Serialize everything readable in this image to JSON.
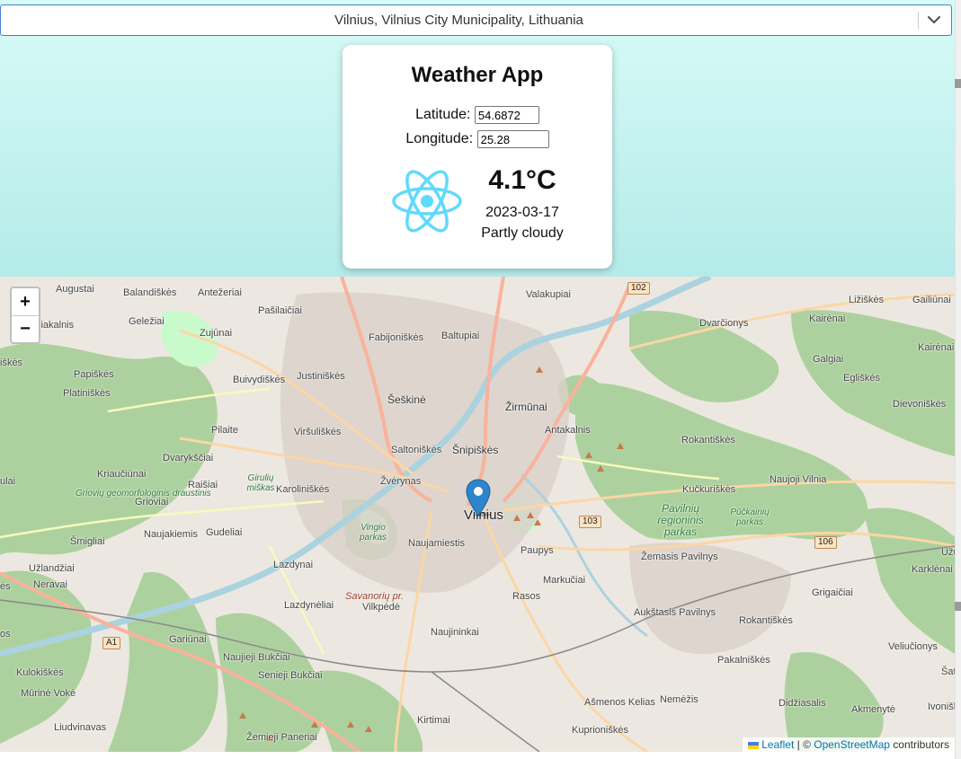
{
  "location_select": {
    "value": "Vilnius, Vilnius City Municipality, Lithuania",
    "icon": "chevron-down-icon"
  },
  "card": {
    "title": "Weather App",
    "latitude_label": "Latitude:",
    "latitude_value": "54.6872",
    "longitude_label": "Longitude:",
    "longitude_value": "25.28",
    "icon": "react-logo-icon",
    "temperature": "4.1°C",
    "date": "2023-03-17",
    "condition": "Partly cloudy"
  },
  "map": {
    "zoom_in": "+",
    "zoom_out": "−",
    "center_label": "Vilnius",
    "marker_icon": "map-pin-icon",
    "labels": [
      "Augustai",
      "Balandiškės",
      "Antežeriai",
      "Pašilaičiai",
      "Fabijoniškės",
      "Baltupiai",
      "Valakupiai",
      "Dvarčionys",
      "Kairėnai",
      "Gailiūnai",
      "Ližiškės",
      "Kairėnai",
      "Geležiai",
      "Zujūnai",
      "Džiakalnis",
      "Papiškės",
      "Platiniškės",
      "Buivydiškės",
      "Justiniškės",
      "Šeškinė",
      "Žirmūnai",
      "Galgiai",
      "Egliškės",
      "Dievoniškės",
      "Pilaite",
      "Viršuliškės",
      "Antakalnis",
      "Rokantiškės",
      "Saltoniškės",
      "Šnipiškės",
      "Dvarykščiai",
      "Kriaučiūnai",
      "Raišiai",
      "Karoliniškės",
      "Žvėrynas",
      "Naujoji Vilnia",
      "Kučkuriškės",
      "Grioviai",
      "Naujakiemis",
      "Gudeliai",
      "Naujamiestis",
      "Paupys",
      "Šmigliai",
      "Užlandžiai",
      "Neravai",
      "Lazdynai",
      "Markučiai",
      "Žemasis Pavilnys",
      "Karklėnai",
      "Rasos",
      "Grigaičiai",
      "Lazdynėliai",
      "Vilkpėdė",
      "Aukštasis Pavilnys",
      "Rokantiškės",
      "Gariūnai",
      "Naujininkai",
      "Veliučionys",
      "Naujieji Bukčiai",
      "Senieji Bukčiai",
      "Pakalniškės",
      "Kulokiškės",
      "Mūrinė Vokė",
      "Ašmenos Kelias",
      "Nemėžis",
      "Didžiasalis",
      "Akmenytė",
      "Ivoniškės",
      "Liudvinavas",
      "Kirtimai",
      "Kuprioniškės",
      "Žemieji Paneriai",
      "Užų",
      "Šat",
      "iškės",
      "ulai",
      "ės",
      "os"
    ],
    "park_labels": [
      "Griovių geomorfologinis draustinis",
      "Girulių miškas",
      "Vingio parkas",
      "Pavilnių regioninis parkas",
      "Pūčkainių parkas",
      "Savanorių pr."
    ],
    "road_numbers": [
      "102",
      "103",
      "106",
      "A1"
    ]
  },
  "attribution": {
    "leaflet": "Leaflet",
    "separator": " | © ",
    "osm": "OpenStreetMap",
    "suffix": " contributors"
  }
}
